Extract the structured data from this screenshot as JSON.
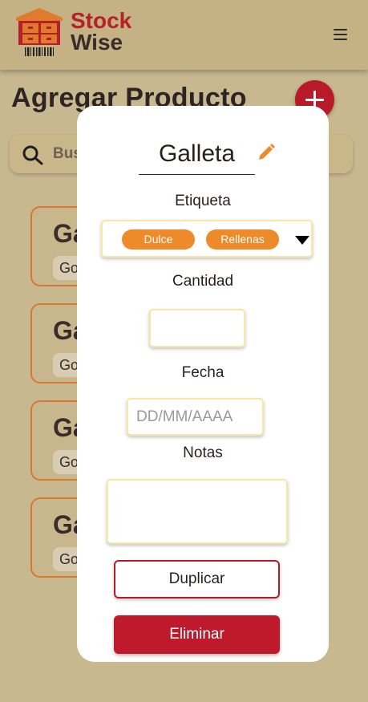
{
  "header": {
    "logo_line1": "Stock",
    "logo_line2": "Wise",
    "logo_icon": "warehouse-barcode-icon",
    "menu_icon": "hamburger-menu-icon"
  },
  "page": {
    "title": "Agregar Producto",
    "add_icon": "plus-icon",
    "search_placeholder": "Bus"
  },
  "cards": [
    {
      "title": "Ga",
      "tag": "Go"
    },
    {
      "title": "Ga",
      "tag": "Go"
    },
    {
      "title": "Ga",
      "tag": "Go"
    },
    {
      "title": "Ga",
      "tag": "Go"
    }
  ],
  "modal": {
    "product_name": "Galleta",
    "edit_icon": "pencil-icon",
    "tag_label": "Etiqueta",
    "tags": [
      "Dulce",
      "Rellenas"
    ],
    "quantity_label": "Cantidad",
    "quantity_value": "",
    "date_label": "Fecha",
    "date_placeholder": "DD/MM/AAAA",
    "notes_label": "Notas",
    "notes_value": "",
    "duplicate_label": "Duplicar",
    "delete_label": "Eliminar"
  },
  "colors": {
    "background": "#c8b88f",
    "header": "#c4b184",
    "brand_red": "#b81a2a",
    "accent_orange": "#ef8a2a",
    "input_border": "#f6e9a8"
  }
}
